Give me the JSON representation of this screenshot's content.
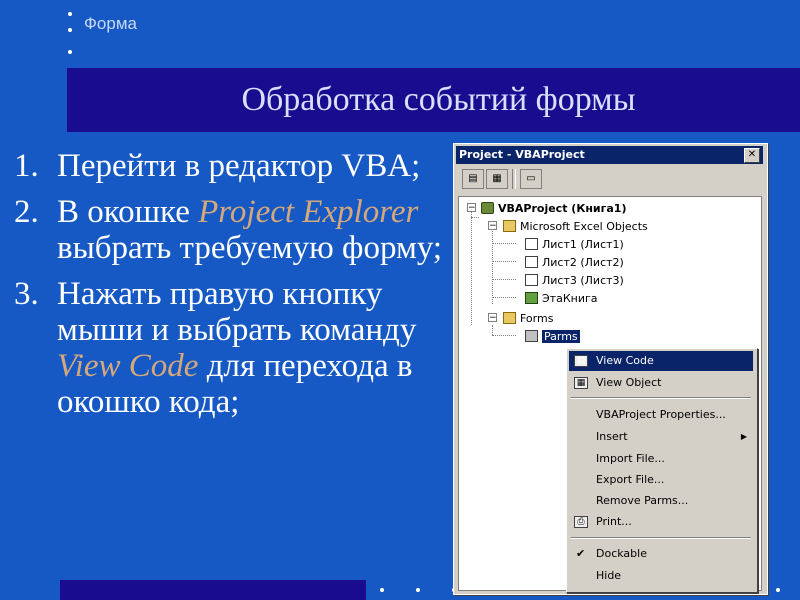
{
  "slide": {
    "section_label": "Форма",
    "title": "Обработка событий формы",
    "steps": [
      {
        "num": "1.",
        "parts": [
          {
            "text": "Перейти в редактор VBA;",
            "accent": false
          }
        ]
      },
      {
        "num": "2.",
        "parts": [
          {
            "text": "В окошке ",
            "accent": false
          },
          {
            "text": "Project Explorer",
            "accent": true
          },
          {
            "text": " выбрать требуемую форму;",
            "accent": false
          }
        ]
      },
      {
        "num": "3.",
        "parts": [
          {
            "text": "Нажать правую кнопку мыши и выбрать команду ",
            "accent": false
          },
          {
            "text": "View Code",
            "accent": true
          },
          {
            "text": " для перехода в окошко кода;",
            "accent": false
          }
        ]
      }
    ],
    "colors": {
      "background": "#1659c4",
      "title_bar": "#1a0c8f",
      "accent_text": "#d4a87a"
    }
  },
  "project_window": {
    "title": "Project - VBAProject",
    "close_glyph": "✕",
    "toolbar": [
      "view-code",
      "view-object",
      "toggle-folders"
    ],
    "tree": {
      "root": "VBAProject (Книга1)",
      "folder_excel": "Microsoft Excel Objects",
      "sheets": [
        "Лист1 (Лист1)",
        "Лист2 (Лист2)",
        "Лист3 (Лист3)"
      ],
      "workbook": "ЭтаКнига",
      "folder_forms": "Forms",
      "form": "Parms"
    }
  },
  "context_menu": {
    "view_code": "View Code",
    "view_object": "View Object",
    "project_properties": "VBAProject Properties...",
    "insert": "Insert",
    "import_file": "Import File...",
    "export_file": "Export File...",
    "remove": "Remove Parms...",
    "print": "Print...",
    "dockable": "Dockable",
    "hide": "Hide",
    "dockable_checked": true
  }
}
